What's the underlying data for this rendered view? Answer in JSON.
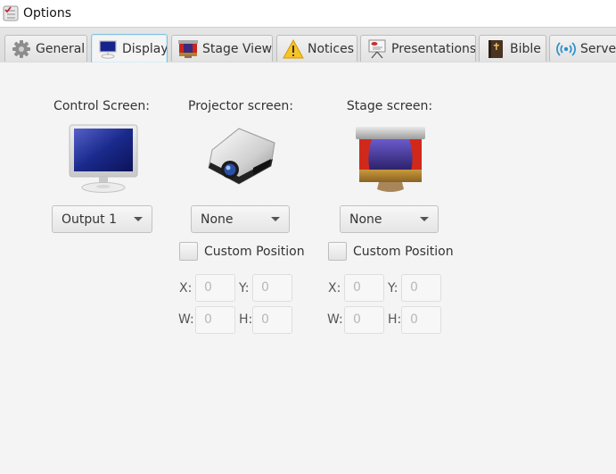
{
  "window": {
    "title": "Options",
    "icon": "options-checklist-icon"
  },
  "tabs": [
    {
      "label": "General",
      "icon": "gear-icon",
      "active": false
    },
    {
      "label": "Display",
      "icon": "monitor-icon",
      "active": true
    },
    {
      "label": "Stage View",
      "icon": "stage-icon",
      "active": false
    },
    {
      "label": "Notices",
      "icon": "warning-icon",
      "active": false
    },
    {
      "label": "Presentations",
      "icon": "presentation-board-icon",
      "active": false
    },
    {
      "label": "Bible",
      "icon": "bible-icon",
      "active": false
    },
    {
      "label": "Server",
      "icon": "wireless-signal-icon",
      "active": false
    }
  ],
  "display": {
    "control": {
      "heading": "Control Screen:",
      "icon": "monitor-icon",
      "selected": "Output 1"
    },
    "projector": {
      "heading": "Projector screen:",
      "icon": "projector-icon",
      "selected": "None",
      "custom_position_label": "Custom Position",
      "custom_position_checked": false,
      "x_label": "X:",
      "x_value": "0",
      "y_label": "Y:",
      "y_value": "0",
      "w_label": "W:",
      "w_value": "0",
      "h_label": "H:",
      "h_value": "0"
    },
    "stage": {
      "heading": "Stage screen:",
      "icon": "stage-icon",
      "selected": "None",
      "custom_position_label": "Custom Position",
      "custom_position_checked": false,
      "x_label": "X:",
      "x_value": "0",
      "y_label": "Y:",
      "y_value": "0",
      "w_label": "W:",
      "w_value": "0",
      "h_label": "H:",
      "h_value": "0"
    }
  },
  "colors": {
    "active_tab_border": "#7fc3dd",
    "background": "#f4f4f4",
    "monitor_screen": "#1a2a8c"
  }
}
